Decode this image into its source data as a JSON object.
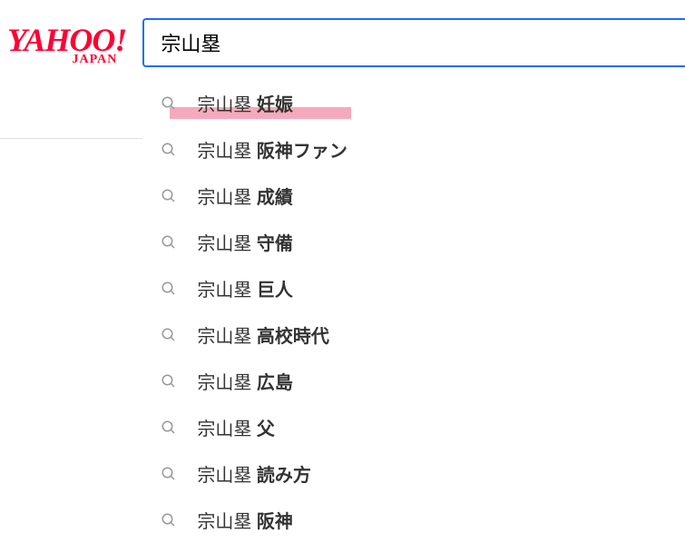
{
  "logo": {
    "main": "YAHOO!",
    "sub": "JAPAN"
  },
  "search": {
    "value": "宗山塁",
    "placeholder": ""
  },
  "suggestions": [
    {
      "prefix": "宗山塁",
      "completion": "妊娠",
      "highlighted": true
    },
    {
      "prefix": "宗山塁",
      "completion": "阪神ファン",
      "highlighted": false
    },
    {
      "prefix": "宗山塁",
      "completion": "成績",
      "highlighted": false
    },
    {
      "prefix": "宗山塁",
      "completion": "守備",
      "highlighted": false
    },
    {
      "prefix": "宗山塁",
      "completion": "巨人",
      "highlighted": false
    },
    {
      "prefix": "宗山塁",
      "completion": "高校時代",
      "highlighted": false
    },
    {
      "prefix": "宗山塁",
      "completion": "広島",
      "highlighted": false
    },
    {
      "prefix": "宗山塁",
      "completion": "父",
      "highlighted": false
    },
    {
      "prefix": "宗山塁",
      "completion": "読み方",
      "highlighted": false
    },
    {
      "prefix": "宗山塁",
      "completion": "阪神",
      "highlighted": false
    }
  ]
}
